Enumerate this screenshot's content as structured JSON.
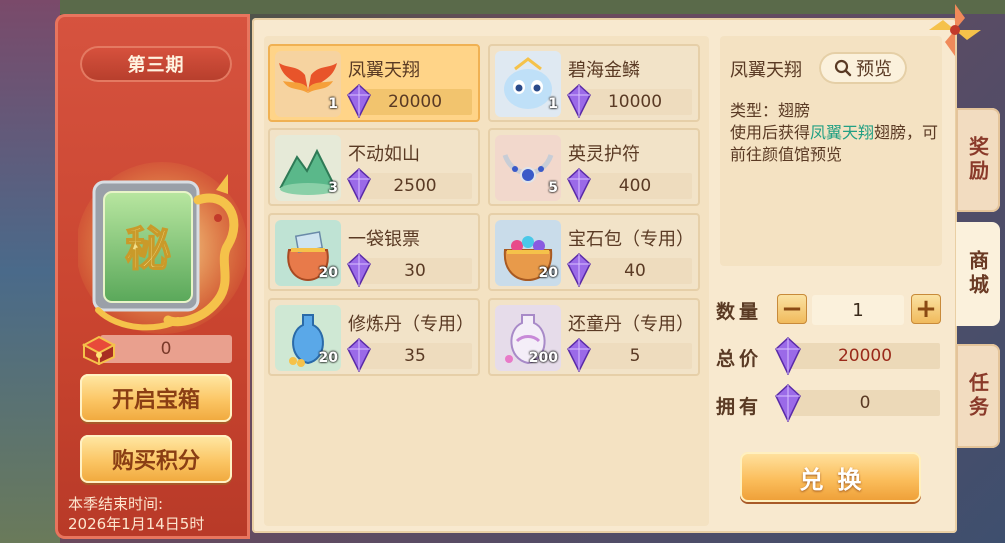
{
  "left": {
    "season_label": "第三期",
    "points_value": "0",
    "open_chest_label": "开启宝箱",
    "buy_points_label": "购买积分",
    "season_end_label": "本季结束时间:",
    "season_end_date": "2026年1月14日5时"
  },
  "items": [
    {
      "name": "凤翼天翔",
      "qty": "1",
      "price": "20000",
      "icon": "phoenix-wings-icon",
      "selected": true
    },
    {
      "name": "碧海金鳞",
      "qty": "1",
      "price": "10000",
      "icon": "sea-dragon-pet-icon",
      "selected": false
    },
    {
      "name": "不动如山",
      "qty": "3",
      "price": "2500",
      "icon": "jade-mountain-icon",
      "selected": false
    },
    {
      "name": "英灵护符",
      "qty": "5",
      "price": "400",
      "icon": "amulet-necklace-icon",
      "selected": false
    },
    {
      "name": "一袋银票",
      "qty": "20",
      "price": "30",
      "icon": "silver-note-bag-icon",
      "selected": false
    },
    {
      "name": "宝石包（专用）",
      "qty": "20",
      "price": "40",
      "icon": "gem-bag-icon",
      "selected": false
    },
    {
      "name": "修炼丹（专用）",
      "qty": "20",
      "price": "35",
      "icon": "cultivation-pill-vase-icon",
      "selected": false
    },
    {
      "name": "还童丹（专用）",
      "qty": "200",
      "price": "5",
      "icon": "rejuvenation-pill-vase-icon",
      "selected": false
    }
  ],
  "detail": {
    "title": "凤翼天翔",
    "preview_label": "预览",
    "type_line": "类型：翅膀",
    "desc_prefix": "使用后获得",
    "desc_highlight": "凤翼天翔",
    "desc_suffix": "翅膀，可前往颜值馆预览",
    "highlight_color": "#23a084"
  },
  "purchase": {
    "quantity_label": "数量",
    "quantity_value": "1",
    "minus_label": "−",
    "plus_label": "+",
    "total_label": "总价",
    "total_value": "20000",
    "owned_label": "拥有",
    "owned_value": "0",
    "exchange_label": "兑换"
  },
  "side_tabs": [
    {
      "label": "奖励",
      "active": false
    },
    {
      "label": "商城",
      "active": true
    },
    {
      "label": "任务",
      "active": false
    }
  ],
  "colors": {
    "panel_red": "#c9442f",
    "gold_button": "#fbc564",
    "paper": "#f8e9cf",
    "selected_item": "#ffd488",
    "price_red": "#9a2a1a",
    "gem_purple": "#8a5ae0"
  }
}
